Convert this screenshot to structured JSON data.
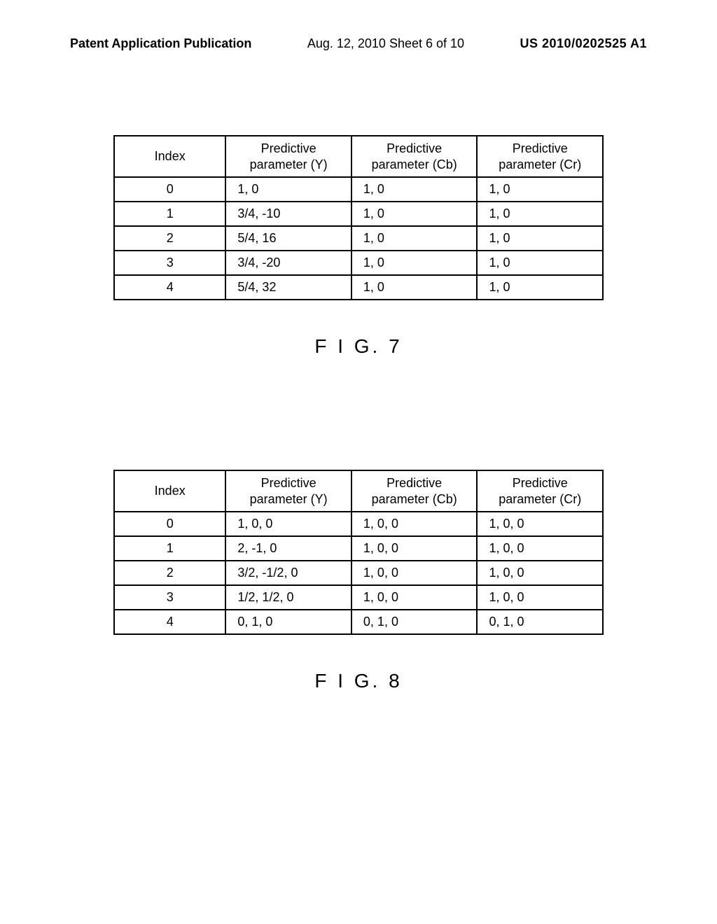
{
  "header": {
    "left": "Patent Application Publication",
    "mid": "Aug. 12, 2010  Sheet 6 of 10",
    "right": "US 2010/0202525 A1"
  },
  "fig7": {
    "caption": "F I G. 7",
    "headers": {
      "index": "Index",
      "y": "Predictive\nparameter (Y)",
      "cb": "Predictive\nparameter (Cb)",
      "cr": "Predictive\nparameter (Cr)"
    },
    "rows": [
      {
        "index": "0",
        "y": "1, 0",
        "cb": "1, 0",
        "cr": "1, 0"
      },
      {
        "index": "1",
        "y": "3/4, -10",
        "cb": "1, 0",
        "cr": "1, 0"
      },
      {
        "index": "2",
        "y": "5/4, 16",
        "cb": "1, 0",
        "cr": "1, 0"
      },
      {
        "index": "3",
        "y": "3/4, -20",
        "cb": "1, 0",
        "cr": "1, 0"
      },
      {
        "index": "4",
        "y": "5/4, 32",
        "cb": "1, 0",
        "cr": "1, 0"
      }
    ]
  },
  "fig8": {
    "caption": "F I G. 8",
    "headers": {
      "index": "Index",
      "y": "Predictive\nparameter (Y)",
      "cb": "Predictive\nparameter (Cb)",
      "cr": "Predictive\nparameter (Cr)"
    },
    "rows": [
      {
        "index": "0",
        "y": "1, 0, 0",
        "cb": "1, 0, 0",
        "cr": "1, 0, 0"
      },
      {
        "index": "1",
        "y": "2, -1, 0",
        "cb": "1, 0, 0",
        "cr": "1, 0, 0"
      },
      {
        "index": "2",
        "y": "3/2, -1/2, 0",
        "cb": "1, 0, 0",
        "cr": "1, 0, 0"
      },
      {
        "index": "3",
        "y": "1/2, 1/2, 0",
        "cb": "1, 0, 0",
        "cr": "1, 0, 0"
      },
      {
        "index": "4",
        "y": "0, 1, 0",
        "cb": "0, 1, 0",
        "cr": "0, 1, 0"
      }
    ]
  },
  "chart_data": [
    {
      "type": "table",
      "title": "FIG. 7",
      "columns": [
        "Index",
        "Predictive parameter (Y)",
        "Predictive parameter (Cb)",
        "Predictive parameter (Cr)"
      ],
      "rows": [
        [
          "0",
          "1, 0",
          "1, 0",
          "1, 0"
        ],
        [
          "1",
          "3/4, -10",
          "1, 0",
          "1, 0"
        ],
        [
          "2",
          "5/4, 16",
          "1, 0",
          "1, 0"
        ],
        [
          "3",
          "3/4, -20",
          "1, 0",
          "1, 0"
        ],
        [
          "4",
          "5/4, 32",
          "1, 0",
          "1, 0"
        ]
      ]
    },
    {
      "type": "table",
      "title": "FIG. 8",
      "columns": [
        "Index",
        "Predictive parameter (Y)",
        "Predictive parameter (Cb)",
        "Predictive parameter (Cr)"
      ],
      "rows": [
        [
          "0",
          "1, 0, 0",
          "1, 0, 0",
          "1, 0, 0"
        ],
        [
          "1",
          "2, -1, 0",
          "1, 0, 0",
          "1, 0, 0"
        ],
        [
          "2",
          "3/2, -1/2, 0",
          "1, 0, 0",
          "1, 0, 0"
        ],
        [
          "3",
          "1/2, 1/2, 0",
          "1, 0, 0",
          "1, 0, 0"
        ],
        [
          "4",
          "0, 1, 0",
          "0, 1, 0",
          "0, 1, 0"
        ]
      ]
    }
  ]
}
